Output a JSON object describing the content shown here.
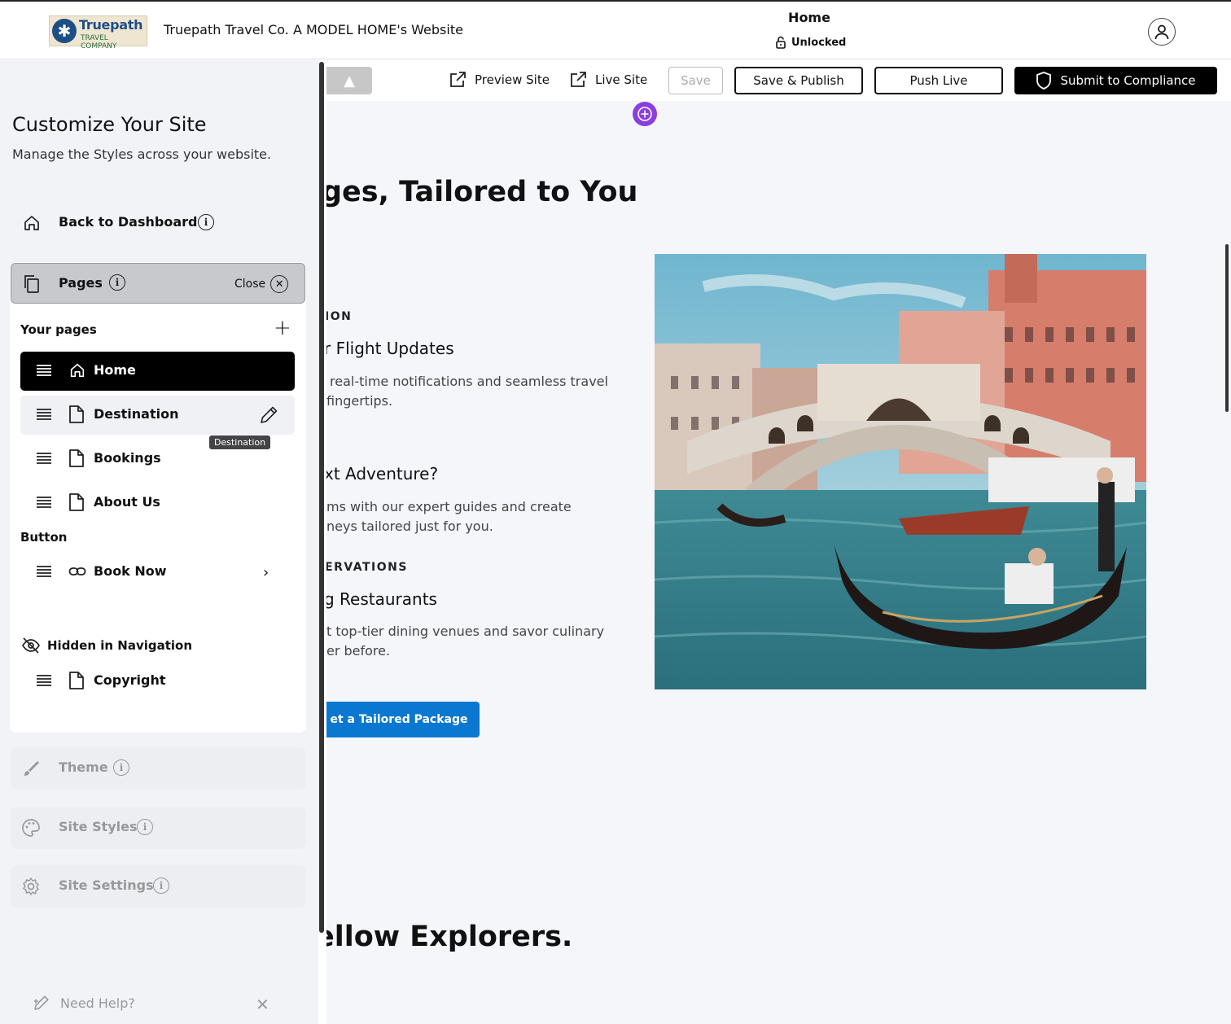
{
  "header": {
    "logo": {
      "brand": "Truepath",
      "sub": "TRAVEL COMPANY"
    },
    "site_title": "Truepath Travel Co. A MODEL HOME's Website",
    "current_page": "Home",
    "lock_status": "Unlocked",
    "user_icon": "user-icon"
  },
  "sidebar": {
    "title": "Customize Your Site",
    "subtitle": "Manage the Styles across your website.",
    "back_label": "Back to Dashboard",
    "pages": {
      "label": "Pages",
      "close_label": "Close",
      "your_pages_label": "Your pages",
      "items": [
        {
          "label": "Home",
          "icon": "home-icon",
          "active": true
        },
        {
          "label": "Destination",
          "icon": "page-icon",
          "hover": true
        },
        {
          "label": "Bookings",
          "icon": "page-icon"
        },
        {
          "label": "About Us",
          "icon": "page-icon"
        }
      ],
      "tooltip": "Destination",
      "button_section_label": "Button",
      "button_item": {
        "label": "Book Now",
        "icon": "link-icon"
      },
      "hidden_label": "Hidden in Navigation",
      "hidden_item": {
        "label": "Copyright",
        "icon": "page-icon"
      }
    },
    "tools": [
      {
        "label": "Theme",
        "icon": "brush-icon"
      },
      {
        "label": "Site Styles",
        "icon": "palette-icon"
      },
      {
        "label": "Site Settings",
        "icon": "gear-icon"
      }
    ],
    "help_label": "Need Help?"
  },
  "toolbar": {
    "preview_label": "Preview Site",
    "live_label": "Live Site",
    "save_label": "Save",
    "save_publish_label": "Save & Publish",
    "push_live_label": "Push Live",
    "compliance_label": "Submit to Compliance"
  },
  "canvas": {
    "heading": "ges, Tailored to You",
    "features": [
      {
        "eyebrow": "ION",
        "title": "r Flight Updates",
        "desc_lines": [
          "real-time notifications and seamless travel",
          "fingertips."
        ]
      },
      {
        "eyebrow": "",
        "title": "xt Adventure?",
        "desc_lines": [
          "ms with our expert guides and create",
          "neys tailored just for you."
        ]
      },
      {
        "eyebrow": "ERVATIONS",
        "title": "g Restaurants",
        "desc_lines": [
          "t top-tier dining venues and savor culinary",
          "er before."
        ]
      }
    ],
    "cta_label": "et a Tailored Package",
    "bottom_heading": "ellow Explorers.",
    "image_subject": "Venice Rialto Bridge with gondolas"
  },
  "colors": {
    "accent_purple": "#8a3ee0",
    "cta_blue": "#0a78d0",
    "active_page_bg": "#000000",
    "canvas_bg": "#f4f6fa"
  }
}
